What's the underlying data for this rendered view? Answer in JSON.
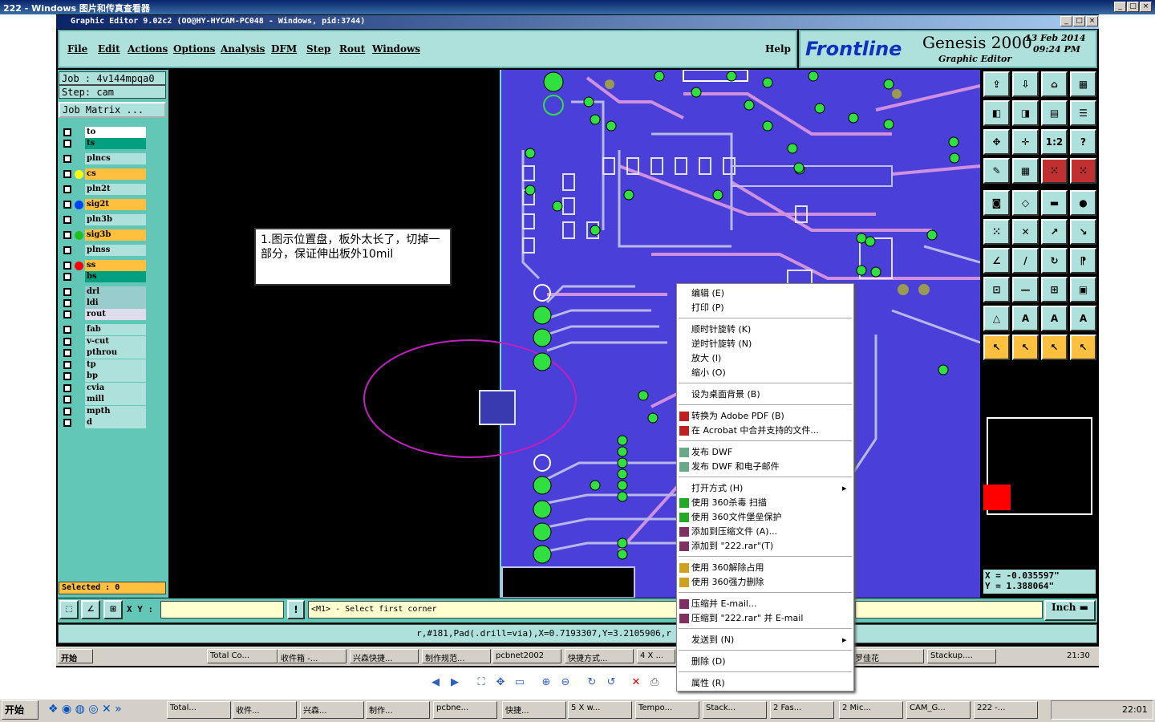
{
  "viewer": {
    "title": "222 - Windows 图片和传真查看器"
  },
  "genesis": {
    "title": "Graphic Editor 9.02c2 (OO@HY-HYCAM-PC048 - Windows, pid:3744)",
    "menu": [
      "File",
      "Edit",
      "Actions",
      "Options",
      "Analysis",
      "DFM",
      "Step",
      "Rout",
      "Windows"
    ],
    "help": "Help",
    "brand": "Frontline",
    "product": "Genesis 2000",
    "subtitle": "Graphic Editor",
    "date": "13 Feb 2014",
    "time": "09:24 PM",
    "job": "Job : 4v144mpqa0",
    "step": "Step: cam",
    "job_matrix": "Job Matrix ...",
    "layers": [
      {
        "name": "to",
        "color": "#ffffff",
        "dot": ""
      },
      {
        "name": "ts",
        "color": "#00a080",
        "dot": ""
      },
      {
        "name": "plncs",
        "color": "#aee0dc",
        "dot": ""
      },
      {
        "name": "cs",
        "color": "#ffc040",
        "dot": "#ffff00"
      },
      {
        "name": "pln2t",
        "color": "#aee0dc",
        "dot": ""
      },
      {
        "name": "sig2t",
        "color": "#ffc040",
        "dot": "#0040ff"
      },
      {
        "name": "pln3b",
        "color": "#aee0dc",
        "dot": ""
      },
      {
        "name": "sig3b",
        "color": "#ffc040",
        "dot": "#20c020"
      },
      {
        "name": "plnss",
        "color": "#aee0dc",
        "dot": ""
      },
      {
        "name": "ss",
        "color": "#ffc040",
        "dot": "#ff0000"
      },
      {
        "name": "bs",
        "color": "#00a080",
        "dot": ""
      },
      {
        "name": "drl",
        "color": "#9cc",
        "dot": ""
      },
      {
        "name": "ldi",
        "color": "#9cc",
        "dot": ""
      },
      {
        "name": "rout",
        "color": "#dde",
        "dot": ""
      },
      {
        "name": "fab",
        "color": "#aee0dc",
        "dot": ""
      },
      {
        "name": "v-cut",
        "color": "#aee0dc",
        "dot": ""
      },
      {
        "name": "pthrou",
        "color": "#aee0dc",
        "dot": ""
      },
      {
        "name": "tp",
        "color": "#aee0dc",
        "dot": ""
      },
      {
        "name": "bp",
        "color": "#aee0dc",
        "dot": ""
      },
      {
        "name": "cvia",
        "color": "#aee0dc",
        "dot": ""
      },
      {
        "name": "mill",
        "color": "#aee0dc",
        "dot": ""
      },
      {
        "name": "mpth",
        "color": "#aee0dc",
        "dot": ""
      },
      {
        "name": "d",
        "color": "#aee0dc",
        "dot": ""
      }
    ],
    "selected": "Selected : 0",
    "xy_label": "X Y :",
    "prompt": "<M1> - Select first corner",
    "info": "r,#181,Pad(.drill=via),X=0.7193307,Y=3.2105906,r",
    "coord_x": "X = -0.035597\"",
    "coord_y": "Y = 1.388064\"",
    "units": "Inch",
    "note": "1.图示位置盘，板外太长了，切掉一部分，保证伸出板外10mil"
  },
  "inner_taskbar": {
    "start": "开始",
    "items": [
      "Total Co...",
      "收件箱 -...",
      "兴森快捷...",
      "制作规范...",
      "pcbnet2002",
      "快捷方式...",
      "4 X ...",
      "罗佳花",
      "Stackup...."
    ],
    "clock": "21:30"
  },
  "context_menu": [
    {
      "label": "编辑 (E)",
      "sep_before": false
    },
    {
      "label": "打印 (P)",
      "sep_before": false
    },
    {
      "label": "顺时针旋转 (K)",
      "sep_before": true
    },
    {
      "label": "逆时针旋转 (N)",
      "sep_before": false
    },
    {
      "label": "放大 (I)",
      "sep_before": false
    },
    {
      "label": "缩小 (O)",
      "sep_before": false
    },
    {
      "label": "设为桌面背景 (B)",
      "sep_before": true
    },
    {
      "label": "转换为 Adobe PDF (B)",
      "sep_before": true,
      "icon": "pdf"
    },
    {
      "label": "在 Acrobat 中合并支持的文件...",
      "sep_before": false,
      "icon": "pdf"
    },
    {
      "label": "发布 DWF",
      "sep_before": true,
      "icon": "dwf"
    },
    {
      "label": "发布 DWF 和电子邮件",
      "sep_before": false,
      "icon": "dwf"
    },
    {
      "label": "打开方式 (H)",
      "sep_before": true,
      "arrow": true
    },
    {
      "label": "使用 360杀毒 扫描",
      "sep_before": false,
      "icon": "shield"
    },
    {
      "label": "使用 360文件堡垒保护",
      "sep_before": false,
      "icon": "shield"
    },
    {
      "label": "添加到压缩文件 (A)...",
      "sep_before": false,
      "icon": "rar"
    },
    {
      "label": "添加到 \"222.rar\"(T)",
      "sep_before": false,
      "icon": "rar"
    },
    {
      "label": "使用 360解除占用",
      "sep_before": true,
      "icon": "folder"
    },
    {
      "label": "使用 360强力删除",
      "sep_before": false,
      "icon": "folder"
    },
    {
      "label": "压缩并 E-mail...",
      "sep_before": true,
      "icon": "rar"
    },
    {
      "label": "压缩到 \"222.rar\" 并 E-mail",
      "sep_before": false,
      "icon": "rar"
    },
    {
      "label": "发送到 (N)",
      "sep_before": true,
      "arrow": true
    },
    {
      "label": "删除 (D)",
      "sep_before": true
    },
    {
      "label": "属性 (R)",
      "sep_before": true
    }
  ],
  "taskbar": {
    "start": "开始",
    "items": [
      "Total...",
      "收件...",
      "兴森...",
      "制作...",
      "pcbne...",
      "快捷...",
      "5 X w...",
      "Tempo...",
      "Stack...",
      "2 Fas...",
      "2 Mic...",
      "CAM_G...",
      "222 -..."
    ],
    "clock": "22:01"
  }
}
